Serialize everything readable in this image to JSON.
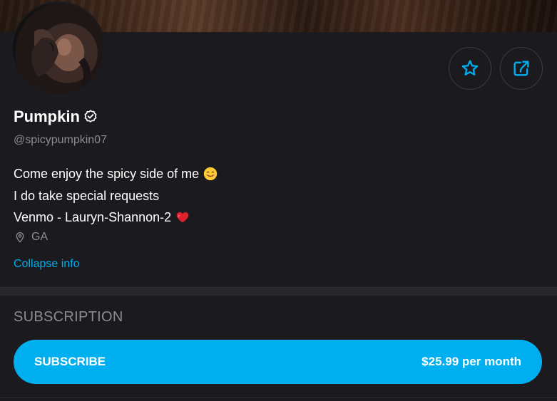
{
  "profile": {
    "name": "Pumpkin",
    "handle": "@spicypumpkin07",
    "bio": [
      "Come enjoy the spicy side of me",
      "I do take special requests",
      "Venmo - Lauryn-Shannon-2"
    ],
    "location": "GA",
    "collapse_label": "Collapse info"
  },
  "icons": {
    "verified": "verified-badge-icon",
    "favorite": "star-icon",
    "share": "share-icon",
    "location": "location-pin-icon",
    "emoji1": "yum-face-emoji",
    "emoji2": "red-heart-emoji"
  },
  "subscription": {
    "title": "SUBSCRIPTION",
    "button_label": "SUBSCRIBE",
    "price": "$25.99 per month"
  },
  "colors": {
    "accent": "#00aff0",
    "background": "#1b1b1f",
    "muted": "#8a8c94"
  }
}
